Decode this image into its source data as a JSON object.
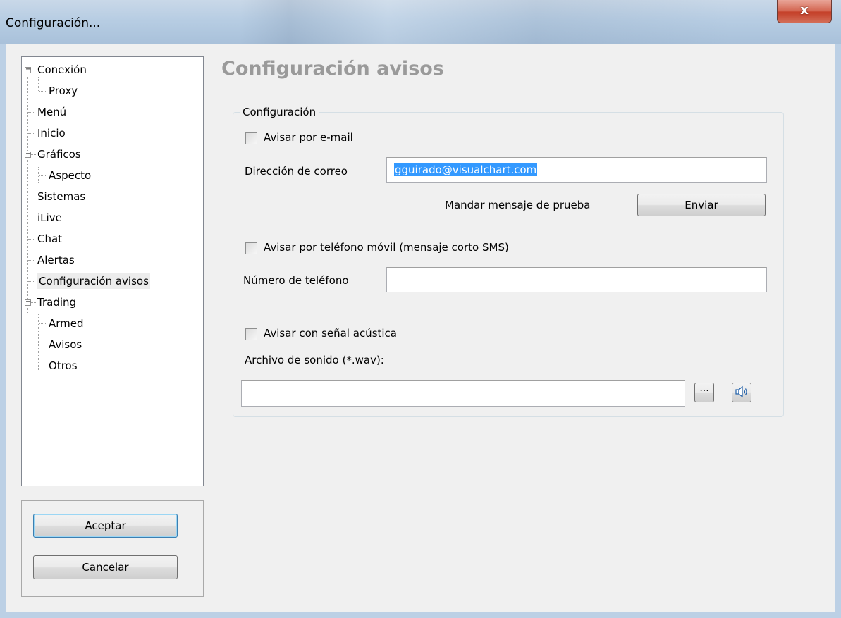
{
  "window": {
    "title": "Configuración...",
    "close_glyph": "x"
  },
  "tree": {
    "items": [
      {
        "label": "Conexión"
      },
      {
        "label": "Proxy"
      },
      {
        "label": "Menú"
      },
      {
        "label": "Inicio"
      },
      {
        "label": "Gráficos"
      },
      {
        "label": "Aspecto"
      },
      {
        "label": "Sistemas"
      },
      {
        "label": "iLive"
      },
      {
        "label": "Chat"
      },
      {
        "label": "Alertas"
      },
      {
        "label": "Configuración avisos"
      },
      {
        "label": "Trading"
      },
      {
        "label": "Armed"
      },
      {
        "label": "Avisos"
      },
      {
        "label": "Otros"
      }
    ],
    "selected": "Configuración avisos",
    "expander_glyph": "−"
  },
  "buttons": {
    "accept": "Aceptar",
    "cancel": "Cancelar"
  },
  "panel": {
    "heading": "Configuración avisos",
    "group_title": "Configuración",
    "email": {
      "checkbox_label": "Avisar por e-mail",
      "checked": false,
      "address_label": "Dirección de correo",
      "address_value": "gguirado@visualchart.com",
      "test_label": "Mandar mensaje de prueba",
      "send_button": "Enviar"
    },
    "sms": {
      "checkbox_label": "Avisar por teléfono móvil (mensaje corto SMS)",
      "checked": false,
      "phone_label": "Número de teléfono",
      "phone_value": ""
    },
    "sound": {
      "checkbox_label": "Avisar con señal acústica",
      "checked": false,
      "file_label": "Archivo de sonido (*.wav):",
      "file_value": "",
      "browse_glyph": "···",
      "play_icon": "speaker-icon"
    }
  },
  "colors": {
    "selection": "#3399ff",
    "heading": "#9a9a9a",
    "close_button": "#c43f28"
  }
}
